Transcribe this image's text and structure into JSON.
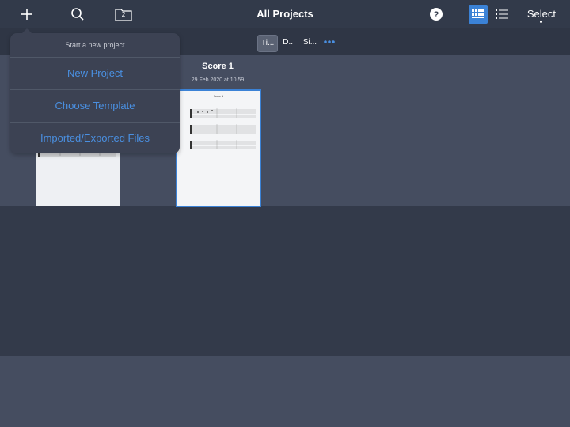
{
  "header": {
    "title": "All Projects",
    "select_label": "Select",
    "folder_count": "2"
  },
  "sort": {
    "options": [
      "Ti...",
      "D...",
      "Si..."
    ],
    "active_index": 0
  },
  "projects": [
    {
      "name": "Score 1",
      "date": "29 Feb 2020 at 10:59",
      "thumb_title": "Score 1",
      "selected": true
    }
  ],
  "popover": {
    "header": "Start a new project",
    "items": [
      "New Project",
      "Choose Template",
      "Imported/Exported Files"
    ]
  },
  "colors": {
    "accent": "#4a90e2",
    "selection_border": "#3b82d6",
    "topbar": "#323a4a",
    "background": "#454d60"
  },
  "icons": [
    "plus-icon",
    "search-icon",
    "folder-icon",
    "help-icon",
    "grid-view-icon",
    "list-view-icon",
    "more-icon"
  ]
}
